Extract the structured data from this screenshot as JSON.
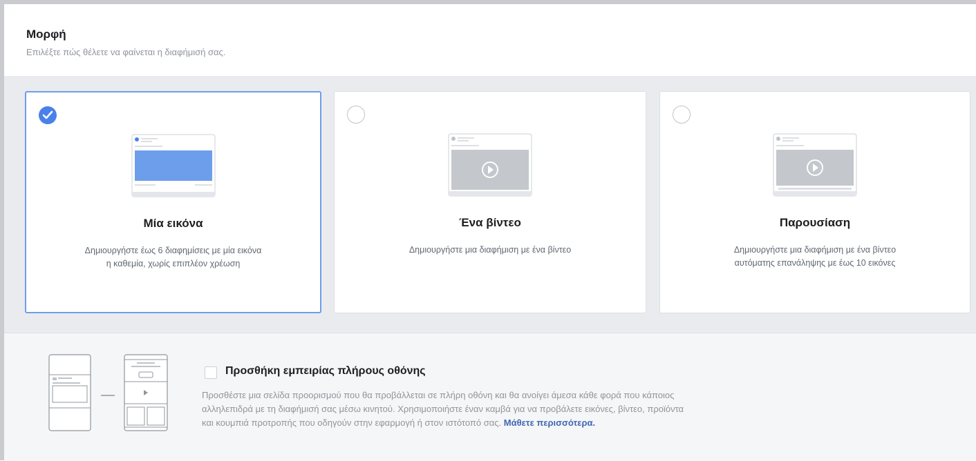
{
  "format": {
    "title": "Μορφή",
    "subtitle": "Επιλέξτε πώς θέλετε να φαίνεται η διαφήμισή σας."
  },
  "options": [
    {
      "title": "Μία εικόνα",
      "description_line1": "Δημιουργήστε έως 6 διαφημίσεις με μία εικόνα",
      "description_line2": "η καθεμία, χωρίς επιπλέον χρέωση",
      "selected": true,
      "icon": "single-image-icon"
    },
    {
      "title": "Ένα βίντεο",
      "description_line1": "Δημιουργήστε μια διαφήμιση με ένα βίντεο",
      "description_line2": "",
      "selected": false,
      "icon": "video-icon"
    },
    {
      "title": "Παρουσίαση",
      "description_line1": "Δημιουργήστε μια διαφήμιση με ένα βίντεο",
      "description_line2": "αυτόματης επανάληψης με έως 10 εικόνες",
      "selected": false,
      "icon": "slideshow-icon"
    }
  ],
  "fullscreen": {
    "checkbox_label": "Προσθήκη εμπειρίας πλήρους οθόνης",
    "checked": false,
    "desc_line1": "Προσθέστε μια σελίδα προορισμού που θα προβάλλεται σε πλήρη οθόνη και θα ανοίγει άμεσα κάθε φορά που κάποιος",
    "desc_line2": "αλληλεπιδρά με τη διαφήμισή σας μέσω κινητού. Χρησιμοποιήστε έναν καμβά για να προβάλετε εικόνες, βίντεο, προϊόντα",
    "desc_line3": "και κουμπιά προτροπής που οδηγούν στην εφαρμογή ή στον ιστότοπό σας.",
    "learn_more": "Μάθετε περισσότερα."
  },
  "colors": {
    "accent": "#4a80ea",
    "selected_border": "#6d9eeb",
    "link": "#4267b2",
    "image_placeholder": "#6d9eeb",
    "video_placeholder": "#c4c7cc"
  }
}
